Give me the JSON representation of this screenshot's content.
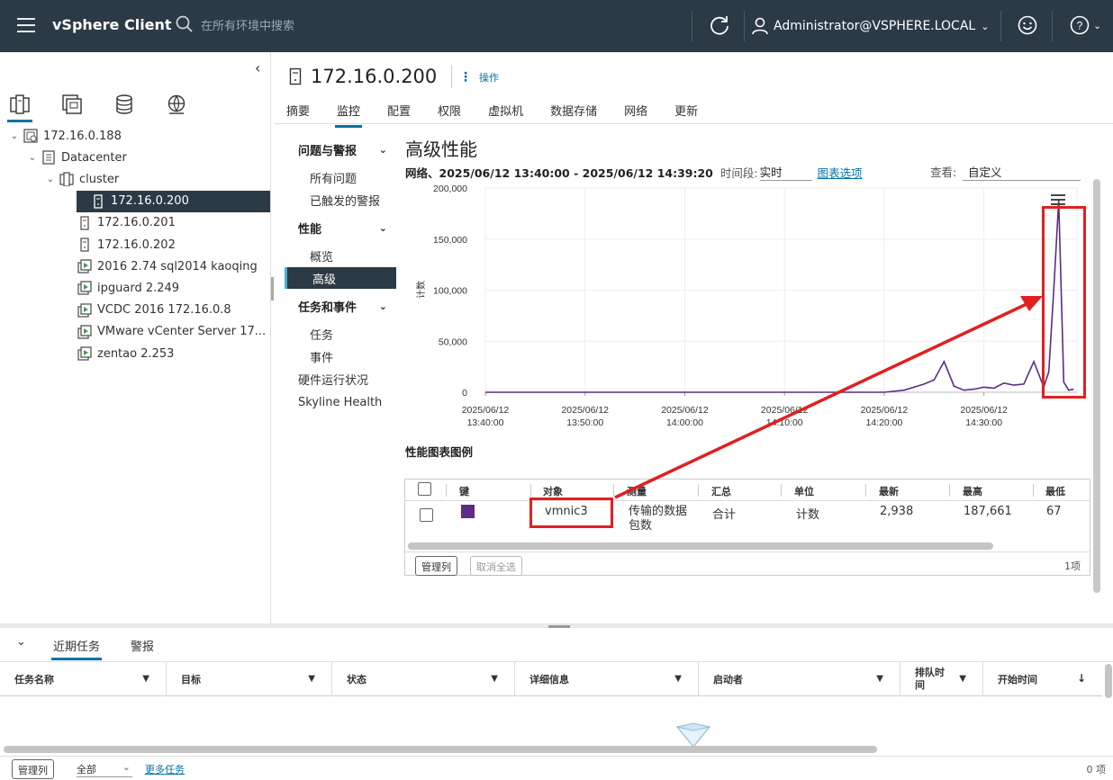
{
  "header": {
    "app_name": "vSphere Client",
    "search_placeholder": "在所有环境中搜索",
    "user": "Administrator@VSPHERE.LOCAL"
  },
  "inventory": {
    "tree": [
      {
        "label": "172.16.0.188",
        "icon": "vcenter-icon",
        "level": 0,
        "expanded": true
      },
      {
        "label": "Datacenter",
        "icon": "datacenter-icon",
        "level": 1,
        "expanded": true
      },
      {
        "label": "cluster",
        "icon": "cluster-icon",
        "level": 2,
        "expanded": true
      },
      {
        "label": "172.16.0.200",
        "icon": "host-icon",
        "level": 3,
        "selected": true
      },
      {
        "label": "172.16.0.201",
        "icon": "host-icon",
        "level": 3
      },
      {
        "label": "172.16.0.202",
        "icon": "host-icon",
        "level": 3
      },
      {
        "label": "2016 2.74 sql2014 kaoqing",
        "icon": "vm-icon",
        "level": 3
      },
      {
        "label": "ipguard 2.249",
        "icon": "vm-icon",
        "level": 3
      },
      {
        "label": "VCDC 2016 172.16.0.8",
        "icon": "vm-icon",
        "level": 3
      },
      {
        "label": "VMware vCenter Server 17...",
        "icon": "vm-icon",
        "level": 3
      },
      {
        "label": "zentao 2.253",
        "icon": "vm-icon",
        "level": 3
      }
    ]
  },
  "object": {
    "title": "172.16.0.200",
    "actions_label": "操作",
    "tabs": [
      "摘要",
      "监控",
      "配置",
      "权限",
      "虚拟机",
      "数据存储",
      "网络",
      "更新"
    ],
    "active_tab": "监控"
  },
  "subnav": {
    "group_issues": "问题与警报",
    "all_issues": "所有问题",
    "triggered_alarms": "已触发的警报",
    "group_perf": "性能",
    "overview": "概览",
    "advanced": "高级",
    "group_tasks": "任务和事件",
    "tasks": "任务",
    "events": "事件",
    "hardware_health": "硬件运行状况",
    "skyline": "Skyline Health"
  },
  "perf": {
    "title": "高级性能",
    "subtitle": "网络、2025/06/12 13:40:00 - 2025/06/12 14:39:20",
    "period_label": "时间段:",
    "period_value": "实时",
    "chart_options": "图表选项",
    "view_label": "查看:",
    "view_value": "自定义",
    "legend_title": "性能图表图例"
  },
  "chart_data": {
    "type": "line",
    "ylabel": "计数",
    "ylim": [
      0,
      200000
    ],
    "yticks": [
      "200,000",
      "150,000",
      "100,000",
      "50,000",
      "0"
    ],
    "xticks": [
      [
        "2025/06/12",
        "13:40:00"
      ],
      [
        "2025/06/12",
        "13:50:00"
      ],
      [
        "2025/06/12",
        "14:00:00"
      ],
      [
        "2025/06/12",
        "14:10:00"
      ],
      [
        "2025/06/12",
        "14:20:00"
      ],
      [
        "2025/06/12",
        "14:30:00"
      ]
    ],
    "series": [
      {
        "color": "#5c2d82",
        "x_minutes": [
          0,
          5,
          10,
          15,
          20,
          25,
          30,
          35,
          40,
          42,
          44,
          45,
          46,
          47,
          48,
          49,
          50,
          51,
          52,
          53,
          54,
          55,
          56,
          56.5,
          57,
          57.5,
          58,
          58.5,
          59
        ],
        "values": [
          0,
          0,
          0,
          0,
          0,
          0,
          0,
          0,
          0,
          2000,
          8000,
          12000,
          30000,
          6000,
          2000,
          3000,
          5000,
          4000,
          9000,
          7000,
          8000,
          30000,
          5000,
          20000,
          100000,
          187661,
          10000,
          2000,
          2938
        ]
      }
    ]
  },
  "legend_table": {
    "columns": [
      "键",
      "对象",
      "测量",
      "汇总",
      "单位",
      "最新",
      "最高",
      "最低"
    ],
    "rows": [
      {
        "color": "#5c2d82",
        "object": "vmnic3",
        "measurement": "传输的数据包数",
        "rollup": "合计",
        "unit": "计数",
        "latest": "2,938",
        "max": "187,661",
        "min": "67"
      }
    ],
    "manage_columns": "管理列",
    "deselect_all": "取消全选",
    "count": "1项"
  },
  "tasks_panel": {
    "tab_recent": "近期任务",
    "tab_alarms": "警报",
    "columns": [
      "任务名称",
      "目标",
      "状态",
      "详细信息",
      "启动者",
      "排队时间",
      "开始时间"
    ],
    "manage_columns": "管理列",
    "filter_value": "全部",
    "more_tasks": "更多任务",
    "count": "0 项"
  }
}
